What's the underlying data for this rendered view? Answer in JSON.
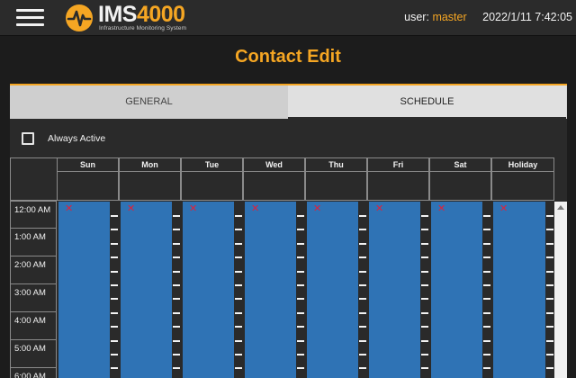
{
  "header": {
    "logo_main": "IMS",
    "logo_number": "4000",
    "logo_subtitle": "Infrastructure Monitoring System",
    "user_label": "user:",
    "user_name": "master",
    "datetime": "2022/1/11 7:42:05"
  },
  "page": {
    "title": "Contact Edit"
  },
  "tabs": [
    {
      "label": "GENERAL",
      "active": false
    },
    {
      "label": "SCHEDULE",
      "active": true
    }
  ],
  "always_active": {
    "label": "Always Active",
    "checked": false
  },
  "schedule": {
    "days": [
      "Sun",
      "Mon",
      "Tue",
      "Wed",
      "Thu",
      "Fri",
      "Sat",
      "Holiday"
    ],
    "times": [
      "12:00 AM",
      "1:00 AM",
      "2:00 AM",
      "3:00 AM",
      "4:00 AM",
      "5:00 AM",
      "6:00 AM"
    ],
    "remove_mark": "✕"
  },
  "colors": {
    "accent": "#f5a623",
    "block": "#2f73b5",
    "remove": "#e0213a"
  }
}
